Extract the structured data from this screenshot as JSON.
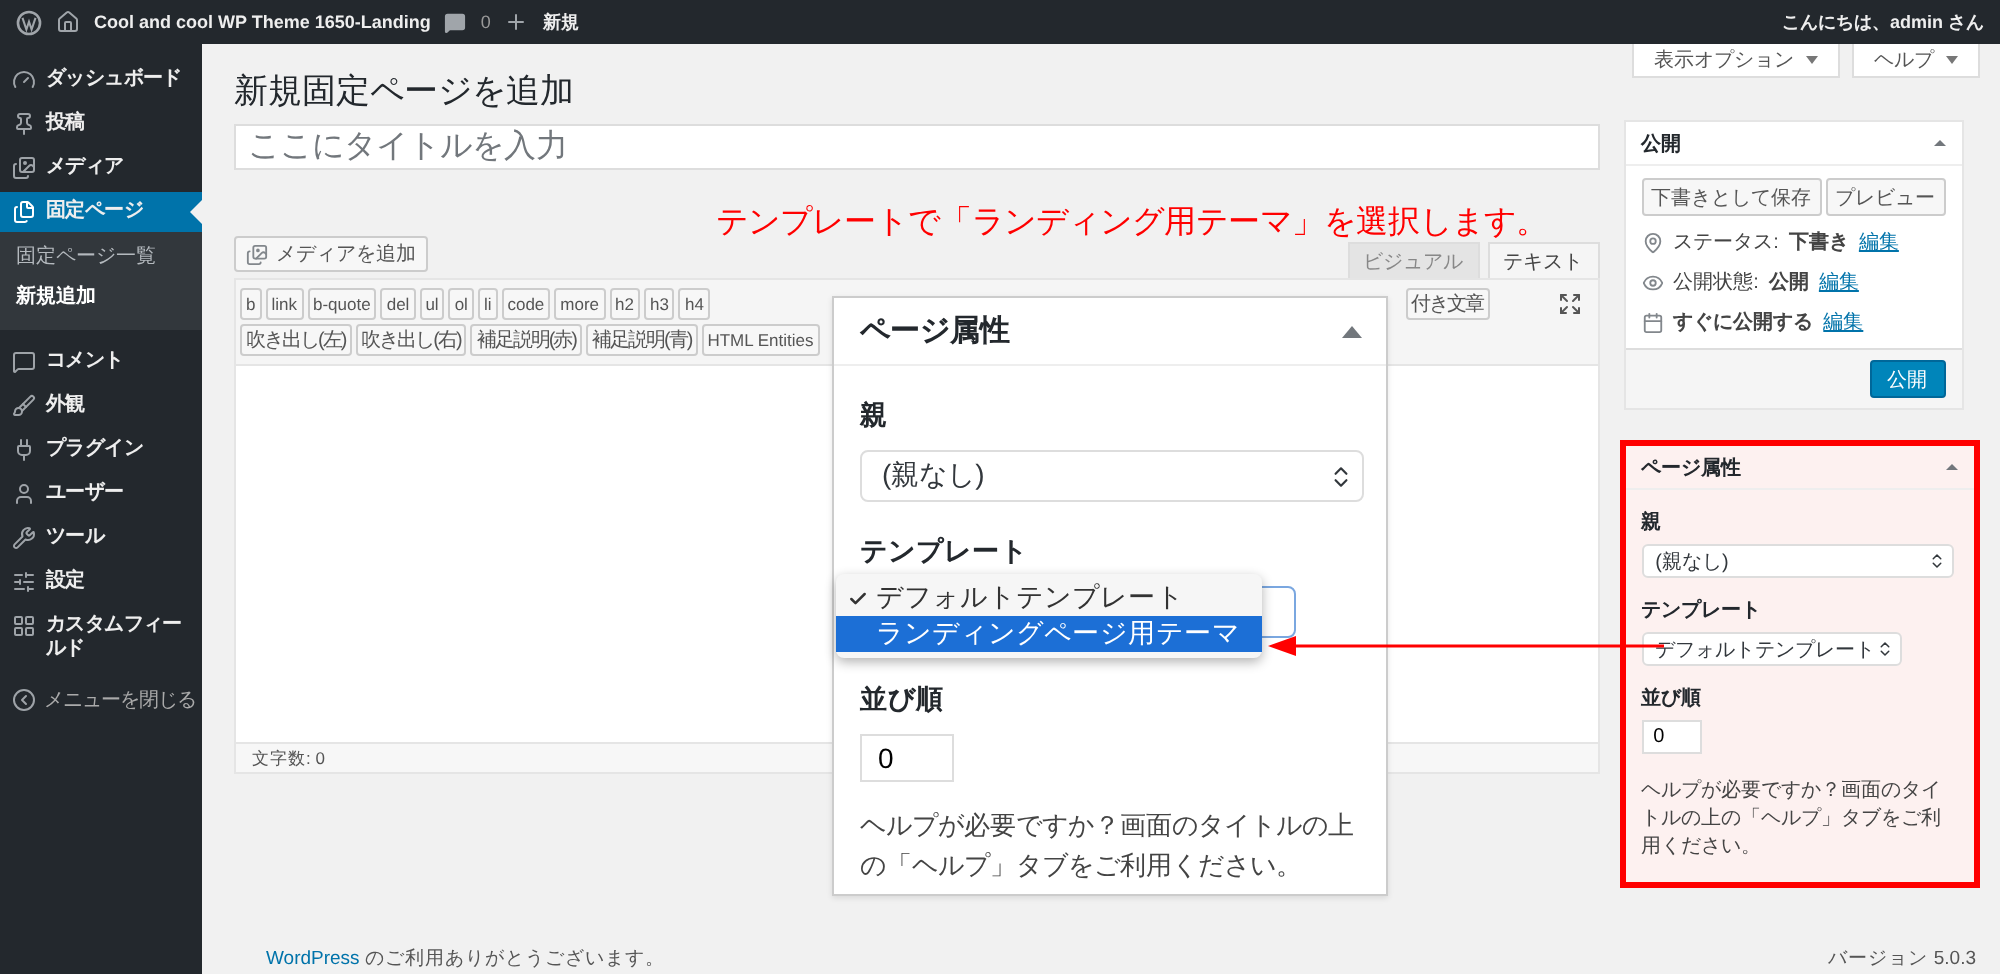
{
  "top_bar": {
    "site_name": "Cool and cool WP Theme 1650-Landing",
    "comments": "0",
    "new_label": "新規",
    "greeting": "こんにちは、admin さん"
  },
  "sidebar": {
    "items": [
      {
        "label": "ダッシュボード",
        "selected": false
      },
      {
        "label": "投稿",
        "selected": false
      },
      {
        "label": "メディア",
        "selected": false
      },
      {
        "label": "固定ページ",
        "selected": true,
        "children": [
          {
            "label": "固定ページ一覧",
            "selected": false
          },
          {
            "label": "新規追加",
            "selected": true
          }
        ]
      },
      {
        "label": "コメント",
        "selected": false
      },
      {
        "label": "外観",
        "selected": false
      },
      {
        "label": "プラグイン",
        "selected": false
      },
      {
        "label": "ユーザー",
        "selected": false
      },
      {
        "label": "ツール",
        "selected": false
      },
      {
        "label": "設定",
        "selected": false
      },
      {
        "label": "カスタムフィールド",
        "selected": false
      }
    ],
    "collapse": "メニューを閉じる"
  },
  "screen_tabs": [
    "表示オプション",
    "ヘルプ"
  ],
  "page_title": "新規固定ページを追加",
  "title_field": {
    "placeholder": "ここにタイトルを入力"
  },
  "add_media": "メディアを追加",
  "editor_tabs": [
    {
      "label": "ビジュアル",
      "selected": false
    },
    {
      "label": "テキスト",
      "selected": true
    }
  ],
  "quicktags": {
    "row_1": [
      "b",
      "link",
      "b-quote",
      "del",
      "ul",
      "ol",
      "li",
      "code",
      "more",
      "h2",
      "h3",
      "h4"
    ],
    "row_1_right": [
      "付き文章"
    ],
    "row_2": [
      "吹き出し(左)",
      "吹き出し(右)",
      "補足説明(赤)",
      "補足説明(青)",
      "HTML Entities"
    ]
  },
  "word_count": "文字数: 0",
  "publish": {
    "title": "公開",
    "save_draft": "下書きとして保存",
    "preview": "プレビュー",
    "rows": [
      {
        "label": "ステータス:",
        "value": "下書き",
        "link": "編集"
      },
      {
        "label": "公開状態:",
        "value": "公開",
        "link": "編集"
      },
      {
        "value": "すぐに公開する",
        "link": "編集"
      }
    ],
    "publish_button": "公開"
  },
  "page_attributes": {
    "highlighted": true,
    "title": "ページ属性",
    "parent_label": "親",
    "parent_value": "(親なし)",
    "template_label": "テンプレート",
    "template_value": "デフォルトテンプレート",
    "order_label": "並び順",
    "order_value": "0",
    "help": "ヘルプが必要ですか？画面のタイトルの上の「ヘルプ」タブをご利用ください。"
  },
  "popup": {
    "title": "ページ属性",
    "parent_label": "親",
    "parent_value": "(親なし)",
    "template_label": "テンプレート",
    "template_options": [
      {
        "label": "デフォルトテンプレート",
        "checked": true,
        "selected": false
      },
      {
        "label": "ランディングページ用テーマ",
        "checked": false,
        "selected": true
      }
    ],
    "order_label": "並び順",
    "order_value": "0",
    "help": "ヘルプが必要ですか？画面のタイトルの上の「ヘルプ」タブをご利用ください。"
  },
  "annotation": "テンプレートで「ランディング用テーマ」を選択します。",
  "footer": {
    "thanks_link": "WordPress",
    "thanks": "のご利用ありがとうございます。",
    "version": "バージョン 5.0.3"
  }
}
